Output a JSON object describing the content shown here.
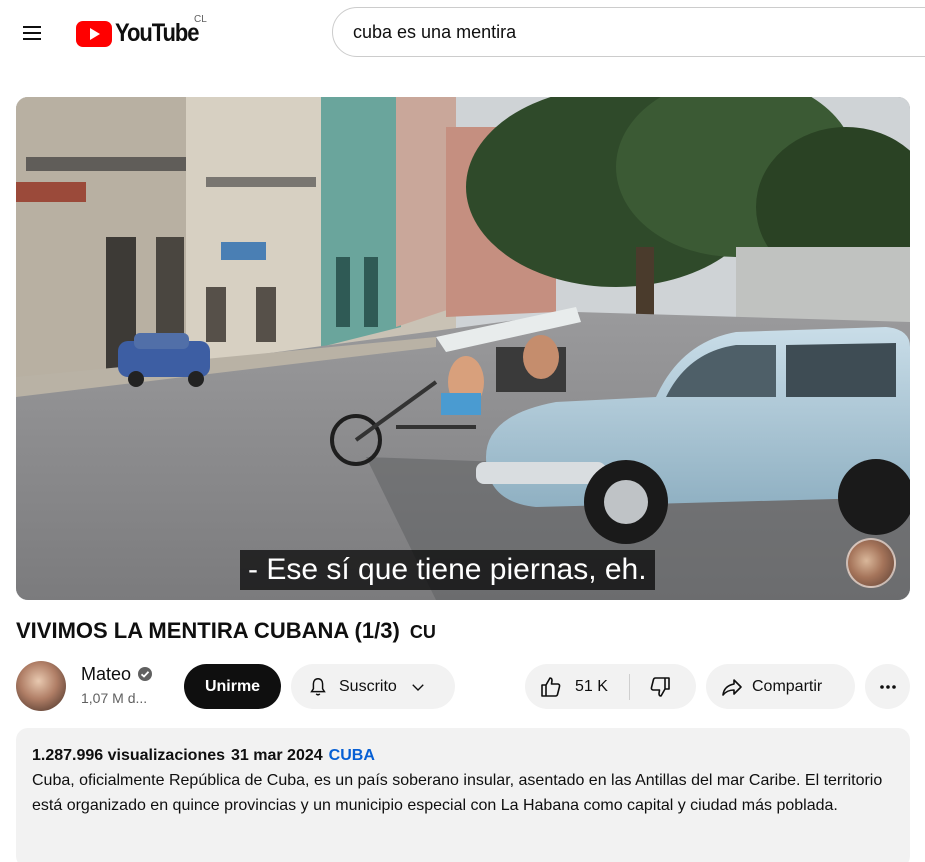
{
  "search": {
    "query": "cuba es una mentira"
  },
  "logo": {
    "wordmark": "YouTube",
    "country_code": "CL"
  },
  "video": {
    "caption": "- Ese sí que tiene piernas, eh.",
    "title": "VIVIMOS LA MENTIRA CUBANA (1/3)",
    "title_flag": "CU"
  },
  "channel": {
    "name": "Mateo",
    "subscribers": "1,07 M d...",
    "join_label": "Unirme",
    "subscribe_label": "Suscrito"
  },
  "actions": {
    "like_count": "51 K",
    "share_label": "Compartir"
  },
  "description": {
    "views": "1.287.996 visualizaciones",
    "date": "31 mar 2024",
    "hashtag": "CUBA",
    "text": "Cuba, oficialmente República de Cuba, es un país soberano insular, asentado en las Antillas del mar Caribe. El territorio está organizado en quince provincias y un municipio especial con La Habana como capital y ciudad más poblada."
  },
  "icons": {
    "menu": "hamburger-menu-icon",
    "logo": "youtube-play-icon",
    "verified": "verified-check-icon",
    "bell": "bell-icon",
    "chevron": "chevron-down-icon",
    "like": "thumbs-up-icon",
    "dislike": "thumbs-down-icon",
    "share": "share-arrow-icon",
    "more": "more-horizontal-icon"
  },
  "colors": {
    "brand_red": "#ff0000",
    "link_blue": "#065fd4",
    "chip_bg": "#f2f2f2",
    "primary_button": "#0f0f0f"
  }
}
